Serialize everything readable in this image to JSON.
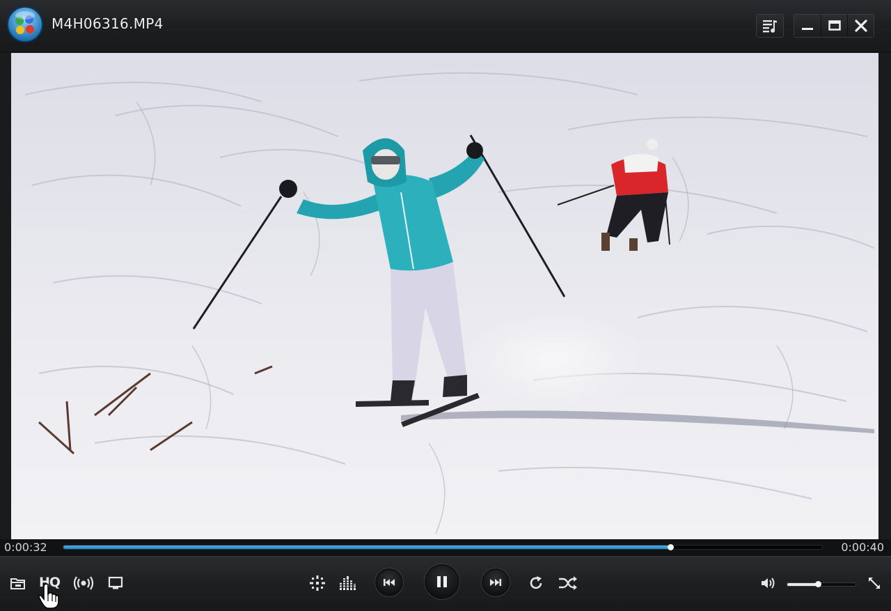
{
  "window": {
    "title": "M4H06316.MP4",
    "app_icon": "media-player-logo",
    "buttons": [
      "playlist-icon",
      "minimize-icon",
      "maximize-icon",
      "close-icon"
    ]
  },
  "player": {
    "current_time": "0:00:32",
    "total_time": "0:00:40",
    "progress": 0.8,
    "volume": 0.45,
    "hq_label": "HQ",
    "accent_color": "#2b9be0"
  },
  "toolbar_left": [
    "open-folder-icon",
    "hq-button",
    "broadcast-icon",
    "screen-icon"
  ],
  "toolbar_center": [
    "effects-icon",
    "equalizer-icon",
    "previous-icon",
    "pause-icon",
    "next-icon",
    "repeat-icon",
    "shuffle-icon"
  ],
  "toolbar_right": [
    "volume-icon",
    "fullscreen-icon"
  ]
}
